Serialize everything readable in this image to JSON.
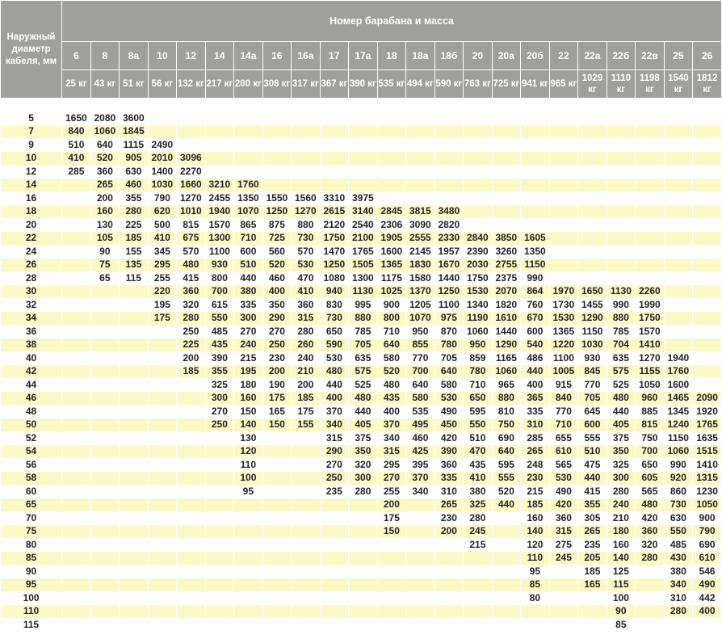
{
  "table": {
    "row_header": "Наружный диаметр кабеля, мм",
    "super_header": "Номер барабана и масса",
    "drums": [
      {
        "number": "6",
        "mass": "25 кг"
      },
      {
        "number": "8",
        "mass": "43 кг"
      },
      {
        "number": "8а",
        "mass": "51 кг"
      },
      {
        "number": "10",
        "mass": "56 кг"
      },
      {
        "number": "12",
        "mass": "132 кг"
      },
      {
        "number": "14",
        "mass": "217 кг"
      },
      {
        "number": "14а",
        "mass": "200 кг"
      },
      {
        "number": "16",
        "mass": "308 кг"
      },
      {
        "number": "16а",
        "mass": "317 кг"
      },
      {
        "number": "17",
        "mass": "367 кг"
      },
      {
        "number": "17а",
        "mass": "390 кг"
      },
      {
        "number": "18",
        "mass": "535 кг"
      },
      {
        "number": "18а",
        "mass": "494 кг"
      },
      {
        "number": "18б",
        "mass": "590 кг"
      },
      {
        "number": "20",
        "mass": "763 кг"
      },
      {
        "number": "20а",
        "mass": "725 кг"
      },
      {
        "number": "20б",
        "mass": "941 кг"
      },
      {
        "number": "22",
        "mass": "965 кг"
      },
      {
        "number": "22а",
        "mass": "1029 кг"
      },
      {
        "number": "22б",
        "mass": "1110 кг"
      },
      {
        "number": "22в",
        "mass": "1198 кг"
      },
      {
        "number": "25",
        "mass": "1540 кг"
      },
      {
        "number": "26",
        "mass": "1812 кг"
      }
    ],
    "rows": [
      {
        "d": "5",
        "v": [
          "1650",
          "2080",
          "3600",
          "",
          "",
          "",
          "",
          "",
          "",
          "",
          "",
          "",
          "",
          "",
          "",
          "",
          "",
          "",
          "",
          "",
          "",
          "",
          ""
        ]
      },
      {
        "d": "7",
        "v": [
          "840",
          "1060",
          "1845",
          "",
          "",
          "",
          "",
          "",
          "",
          "",
          "",
          "",
          "",
          "",
          "",
          "",
          "",
          "",
          "",
          "",
          "",
          "",
          ""
        ]
      },
      {
        "d": "9",
        "v": [
          "510",
          "640",
          "1115",
          "2490",
          "",
          "",
          "",
          "",
          "",
          "",
          "",
          "",
          "",
          "",
          "",
          "",
          "",
          "",
          "",
          "",
          "",
          "",
          ""
        ]
      },
      {
        "d": "10",
        "v": [
          "410",
          "520",
          "905",
          "2010",
          "3096",
          "",
          "",
          "",
          "",
          "",
          "",
          "",
          "",
          "",
          "",
          "",
          "",
          "",
          "",
          "",
          "",
          "",
          ""
        ]
      },
      {
        "d": "12",
        "v": [
          "285",
          "360",
          "630",
          "1400",
          "2270",
          "",
          "",
          "",
          "",
          "",
          "",
          "",
          "",
          "",
          "",
          "",
          "",
          "",
          "",
          "",
          "",
          "",
          ""
        ]
      },
      {
        "d": "14",
        "v": [
          "",
          "265",
          "460",
          "1030",
          "1660",
          "3210",
          "1760",
          "",
          "",
          "",
          "",
          "",
          "",
          "",
          "",
          "",
          "",
          "",
          "",
          "",
          "",
          "",
          ""
        ]
      },
      {
        "d": "16",
        "v": [
          "",
          "200",
          "355",
          "790",
          "1270",
          "2455",
          "1350",
          "1550",
          "1560",
          "3310",
          "3975",
          "",
          "",
          "",
          "",
          "",
          "",
          "",
          "",
          "",
          "",
          "",
          ""
        ]
      },
      {
        "d": "18",
        "v": [
          "",
          "160",
          "280",
          "620",
          "1010",
          "1940",
          "1070",
          "1250",
          "1270",
          "2615",
          "3140",
          "2845",
          "3815",
          "3480",
          "",
          "",
          "",
          "",
          "",
          "",
          "",
          "",
          ""
        ]
      },
      {
        "d": "20",
        "v": [
          "",
          "130",
          "225",
          "500",
          "815",
          "1570",
          "865",
          "875",
          "880",
          "2120",
          "2540",
          "2306",
          "3090",
          "2820",
          "",
          "",
          "",
          "",
          "",
          "",
          "",
          "",
          ""
        ]
      },
      {
        "d": "22",
        "v": [
          "",
          "105",
          "185",
          "410",
          "675",
          "1300",
          "710",
          "725",
          "730",
          "1750",
          "2100",
          "1905",
          "2555",
          "2330",
          "2840",
          "3850",
          "1605",
          "",
          "",
          "",
          "",
          "",
          ""
        ]
      },
      {
        "d": "24",
        "v": [
          "",
          "90",
          "155",
          "345",
          "570",
          "1100",
          "600",
          "560",
          "570",
          "1470",
          "1765",
          "1600",
          "2145",
          "1957",
          "2390",
          "3260",
          "1350",
          "",
          "",
          "",
          "",
          "",
          ""
        ]
      },
      {
        "d": "26",
        "v": [
          "",
          "75",
          "135",
          "295",
          "480",
          "930",
          "510",
          "520",
          "530",
          "1250",
          "1505",
          "1365",
          "1830",
          "1670",
          "2030",
          "2755",
          "1150",
          "",
          "",
          "",
          "",
          "",
          ""
        ]
      },
      {
        "d": "28",
        "v": [
          "",
          "65",
          "115",
          "255",
          "415",
          "800",
          "440",
          "460",
          "470",
          "1080",
          "1300",
          "1175",
          "1580",
          "1440",
          "1750",
          "2375",
          "990",
          "",
          "",
          "",
          "",
          "",
          ""
        ]
      },
      {
        "d": "30",
        "v": [
          "",
          "",
          "",
          "220",
          "360",
          "700",
          "380",
          "400",
          "410",
          "940",
          "1130",
          "1025",
          "1370",
          "1250",
          "1530",
          "2070",
          "864",
          "1970",
          "1650",
          "1130",
          "2260",
          "",
          ""
        ]
      },
      {
        "d": "32",
        "v": [
          "",
          "",
          "",
          "195",
          "320",
          "615",
          "335",
          "350",
          "360",
          "830",
          "995",
          "900",
          "1205",
          "1100",
          "1340",
          "1820",
          "760",
          "1730",
          "1455",
          "990",
          "1990",
          "",
          ""
        ]
      },
      {
        "d": "34",
        "v": [
          "",
          "",
          "",
          "175",
          "280",
          "550",
          "300",
          "290",
          "315",
          "730",
          "880",
          "800",
          "1070",
          "975",
          "1190",
          "1610",
          "670",
          "1530",
          "1290",
          "880",
          "1750",
          "",
          ""
        ]
      },
      {
        "d": "36",
        "v": [
          "",
          "",
          "",
          "",
          "250",
          "485",
          "270",
          "270",
          "280",
          "650",
          "785",
          "710",
          "950",
          "870",
          "1060",
          "1440",
          "600",
          "1365",
          "1150",
          "785",
          "1570",
          "",
          ""
        ]
      },
      {
        "d": "38",
        "v": [
          "",
          "",
          "",
          "",
          "225",
          "435",
          "240",
          "250",
          "260",
          "590",
          "705",
          "640",
          "855",
          "780",
          "950",
          "1290",
          "540",
          "1220",
          "1030",
          "704",
          "1410",
          "",
          ""
        ]
      },
      {
        "d": "40",
        "v": [
          "",
          "",
          "",
          "",
          "200",
          "390",
          "215",
          "230",
          "240",
          "530",
          "635",
          "580",
          "770",
          "705",
          "859",
          "1165",
          "486",
          "1100",
          "930",
          "635",
          "1270",
          "1940",
          ""
        ]
      },
      {
        "d": "42",
        "v": [
          "",
          "",
          "",
          "",
          "185",
          "355",
          "195",
          "200",
          "210",
          "480",
          "575",
          "520",
          "700",
          "640",
          "780",
          "1060",
          "440",
          "1005",
          "845",
          "575",
          "1155",
          "1760",
          ""
        ]
      },
      {
        "d": "44",
        "v": [
          "",
          "",
          "",
          "",
          "",
          "325",
          "180",
          "190",
          "200",
          "440",
          "525",
          "480",
          "640",
          "580",
          "710",
          "965",
          "400",
          "915",
          "770",
          "525",
          "1050",
          "1600",
          ""
        ]
      },
      {
        "d": "46",
        "v": [
          "",
          "",
          "",
          "",
          "",
          "300",
          "160",
          "175",
          "185",
          "400",
          "480",
          "435",
          "580",
          "530",
          "650",
          "880",
          "365",
          "840",
          "705",
          "480",
          "960",
          "1465",
          "2090"
        ]
      },
      {
        "d": "48",
        "v": [
          "",
          "",
          "",
          "",
          "",
          "270",
          "150",
          "165",
          "175",
          "370",
          "440",
          "400",
          "535",
          "490",
          "595",
          "810",
          "335",
          "770",
          "645",
          "440",
          "885",
          "1345",
          "1920"
        ]
      },
      {
        "d": "50",
        "v": [
          "",
          "",
          "",
          "",
          "",
          "250",
          "140",
          "150",
          "155",
          "340",
          "405",
          "370",
          "495",
          "450",
          "550",
          "750",
          "310",
          "710",
          "600",
          "405",
          "815",
          "1240",
          "1765"
        ]
      },
      {
        "d": "52",
        "v": [
          "",
          "",
          "",
          "",
          "",
          "",
          "130",
          "",
          "",
          "315",
          "375",
          "340",
          "460",
          "420",
          "510",
          "690",
          "285",
          "655",
          "555",
          "375",
          "750",
          "1150",
          "1635"
        ]
      },
      {
        "d": "54",
        "v": [
          "",
          "",
          "",
          "",
          "",
          "",
          "120",
          "",
          "",
          "290",
          "350",
          "315",
          "425",
          "390",
          "470",
          "640",
          "265",
          "610",
          "510",
          "350",
          "700",
          "1060",
          "1515"
        ]
      },
      {
        "d": "56",
        "v": [
          "",
          "",
          "",
          "",
          "",
          "",
          "110",
          "",
          "",
          "270",
          "320",
          "295",
          "395",
          "360",
          "435",
          "595",
          "248",
          "565",
          "475",
          "325",
          "650",
          "990",
          "1410"
        ]
      },
      {
        "d": "58",
        "v": [
          "",
          "",
          "",
          "",
          "",
          "",
          "100",
          "",
          "",
          "250",
          "300",
          "270",
          "370",
          "335",
          "410",
          "555",
          "230",
          "530",
          "440",
          "300",
          "605",
          "920",
          "1315"
        ]
      },
      {
        "d": "60",
        "v": [
          "",
          "",
          "",
          "",
          "",
          "",
          "95",
          "",
          "",
          "235",
          "280",
          "255",
          "340",
          "310",
          "380",
          "520",
          "215",
          "490",
          "415",
          "280",
          "565",
          "860",
          "1230"
        ]
      },
      {
        "d": "65",
        "v": [
          "",
          "",
          "",
          "",
          "",
          "",
          "",
          "",
          "",
          "",
          "",
          "200",
          "",
          "265",
          "325",
          "440",
          "185",
          "420",
          "355",
          "240",
          "480",
          "730",
          "1050"
        ]
      },
      {
        "d": "70",
        "v": [
          "",
          "",
          "",
          "",
          "",
          "",
          "",
          "",
          "",
          "",
          "",
          "175",
          "",
          "230",
          "280",
          "",
          "160",
          "360",
          "305",
          "210",
          "420",
          "630",
          "900"
        ]
      },
      {
        "d": "75",
        "v": [
          "",
          "",
          "",
          "",
          "",
          "",
          "",
          "",
          "",
          "",
          "",
          "150",
          "",
          "200",
          "245",
          "",
          "140",
          "315",
          "265",
          "180",
          "360",
          "550",
          "790"
        ]
      },
      {
        "d": "80",
        "v": [
          "",
          "",
          "",
          "",
          "",
          "",
          "",
          "",
          "",
          "",
          "",
          "",
          "",
          "",
          "215",
          "",
          "120",
          "275",
          "235",
          "160",
          "320",
          "485",
          "690"
        ]
      },
      {
        "d": "85",
        "v": [
          "",
          "",
          "",
          "",
          "",
          "",
          "",
          "",
          "",
          "",
          "",
          "",
          "",
          "",
          "",
          "",
          "110",
          "245",
          "205",
          "140",
          "280",
          "430",
          "610"
        ]
      },
      {
        "d": "90",
        "v": [
          "",
          "",
          "",
          "",
          "",
          "",
          "",
          "",
          "",
          "",
          "",
          "",
          "",
          "",
          "",
          "",
          "95",
          "",
          "185",
          "125",
          "",
          "380",
          "546"
        ]
      },
      {
        "d": "95",
        "v": [
          "",
          "",
          "",
          "",
          "",
          "",
          "",
          "",
          "",
          "",
          "",
          "",
          "",
          "",
          "",
          "",
          "85",
          "",
          "165",
          "115",
          "",
          "340",
          "490"
        ]
      },
      {
        "d": "100",
        "v": [
          "",
          "",
          "",
          "",
          "",
          "",
          "",
          "",
          "",
          "",
          "",
          "",
          "",
          "",
          "",
          "",
          "80",
          "",
          "",
          "100",
          "",
          "310",
          "442"
        ]
      },
      {
        "d": "110",
        "v": [
          "",
          "",
          "",
          "",
          "",
          "",
          "",
          "",
          "",
          "",
          "",
          "",
          "",
          "",
          "",
          "",
          "",
          "",
          "",
          "90",
          "",
          "280",
          "400"
        ]
      },
      {
        "d": "115",
        "v": [
          "",
          "",
          "",
          "",
          "",
          "",
          "",
          "",
          "",
          "",
          "",
          "",
          "",
          "",
          "",
          "",
          "",
          "",
          "",
          "85",
          "",
          "",
          ""
        ]
      }
    ]
  }
}
